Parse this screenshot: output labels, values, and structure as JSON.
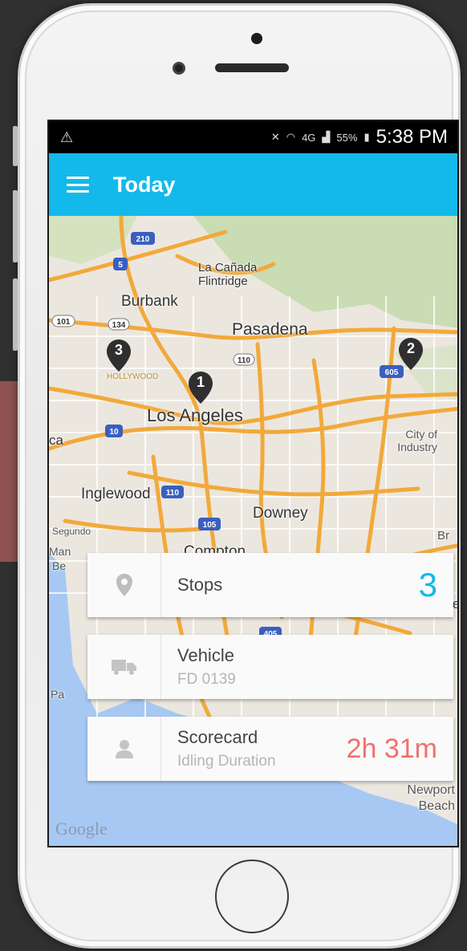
{
  "status_bar": {
    "left_icon": "warning-icon",
    "network": "4G",
    "battery": "55%",
    "time": "5:38 PM"
  },
  "app_bar": {
    "title": "Today",
    "menu_icon": "menu-icon"
  },
  "map": {
    "labels": [
      "La Cañada Flintridge",
      "Burbank",
      "Pasadena",
      "HOLLYWOOD",
      "Los Angeles",
      "City of Industry",
      "Inglewood",
      "Downey",
      "Segundo",
      "Compton",
      "Newport Beach",
      "Br",
      "ca",
      "Man",
      "Be",
      "ahe",
      "Pa"
    ],
    "highway_shields": [
      "210",
      "5",
      "101",
      "134",
      "110",
      "605",
      "10",
      "110",
      "105",
      "405"
    ],
    "pins": [
      {
        "number": "1"
      },
      {
        "number": "2"
      },
      {
        "number": "3"
      }
    ],
    "attribution": "Google"
  },
  "cards": {
    "stops": {
      "icon": "location-pin-icon",
      "title": "Stops",
      "value": "3"
    },
    "vehicle": {
      "icon": "truck-icon",
      "title": "Vehicle",
      "subtitle": "FD 0139"
    },
    "scorecard": {
      "icon": "person-icon",
      "title": "Scorecard",
      "subtitle": "Idling Duration",
      "value": "2h 31m"
    }
  },
  "colors": {
    "accent": "#13b9ea",
    "score": "#f07070",
    "highway": "#f2a93b"
  }
}
